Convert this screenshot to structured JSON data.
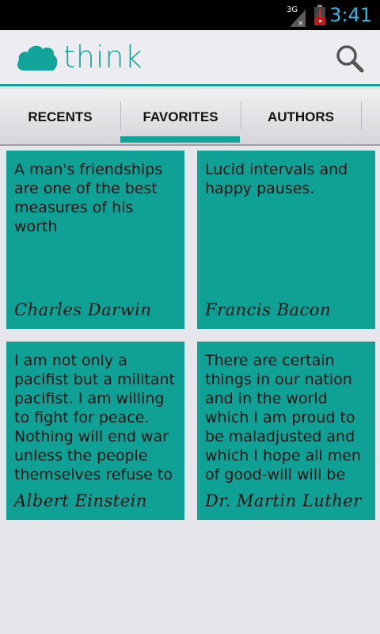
{
  "status_bar": {
    "network": "3G",
    "time": "3:41"
  },
  "app": {
    "name": "think",
    "accent_color": "#12a49a"
  },
  "tabs": [
    {
      "label": "RECENTS",
      "selected": false
    },
    {
      "label": "FAVORITES",
      "selected": true
    },
    {
      "label": "AUTHORS",
      "selected": false
    }
  ],
  "quotes": [
    {
      "text": "A man's friendships are one of the best measures of his worth",
      "author": "Charles Darwin"
    },
    {
      "text": "Lucid intervals and happy pauses.",
      "author": "Francis Bacon"
    },
    {
      "text": "I am not only a pacifist but a militant pacifist. I am willing to fight for peace. Nothing will end war unless the people themselves refuse to",
      "author": "Albert Einstein"
    },
    {
      "text": "There are certain things in our nation and in the world which I am proud to be maladjusted and which I hope all men of good-will will be",
      "author": "Dr. Martin Luther"
    }
  ],
  "icons": {
    "logo": "cloud-icon",
    "search": "search-icon",
    "signal": "signal-icon",
    "battery": "battery-icon"
  }
}
